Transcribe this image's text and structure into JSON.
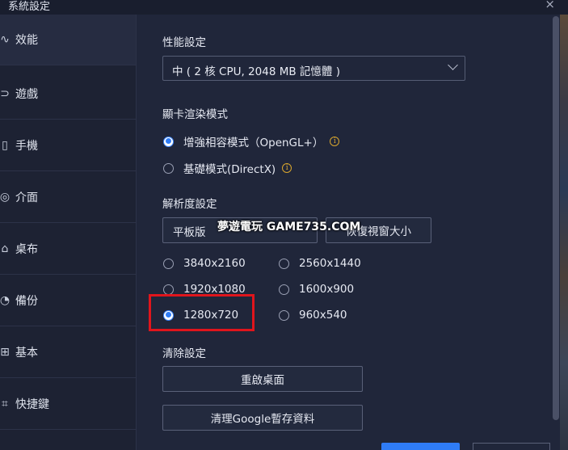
{
  "window": {
    "title": "系統設定",
    "close_glyph": "×"
  },
  "sidebar": {
    "items": [
      {
        "label": "效能",
        "icon": "pulse-icon",
        "glyph": "∿"
      },
      {
        "label": "遊戲",
        "icon": "gamepad-icon",
        "glyph": "⊃"
      },
      {
        "label": "手機",
        "icon": "phone-icon",
        "glyph": "▯"
      },
      {
        "label": "介面",
        "icon": "palette-icon",
        "glyph": "◎"
      },
      {
        "label": "桌布",
        "icon": "wallpaper-icon",
        "glyph": "⌂"
      },
      {
        "label": "備份",
        "icon": "backup-icon",
        "glyph": "◔"
      },
      {
        "label": "基本",
        "icon": "settings-icon",
        "glyph": "⊞"
      },
      {
        "label": "快捷鍵",
        "icon": "keyboard-icon",
        "glyph": "⌗"
      }
    ],
    "active_index": 0
  },
  "performance": {
    "title": "性能設定",
    "selected": "中 ( 2 核 CPU, 2048 MB 記憶體 )"
  },
  "graphics": {
    "title": "顯卡渲染模式",
    "options": [
      {
        "label": "增強相容模式（OpenGL+）",
        "selected": true
      },
      {
        "label": "基礎模式(DirectX)",
        "selected": false
      }
    ]
  },
  "resolution": {
    "title": "解析度設定",
    "preset": "平板版",
    "restore_label": "恢復視窗大小",
    "options": [
      {
        "label": "3840x2160",
        "selected": false
      },
      {
        "label": "2560x1440",
        "selected": false
      },
      {
        "label": "1920x1080",
        "selected": false
      },
      {
        "label": "1600x900",
        "selected": false
      },
      {
        "label": "1280x720",
        "selected": true
      },
      {
        "label": "960x540",
        "selected": false
      }
    ]
  },
  "clear": {
    "title": "清除設定",
    "restart_label": "重啟桌面",
    "clear_google_label": "清理Google暫存資料"
  },
  "watermark": "夢遊電玩 GAME735.COM",
  "colors": {
    "accent": "#2f7cf6",
    "highlight": "#e0151c",
    "info": "#d9a62e"
  }
}
